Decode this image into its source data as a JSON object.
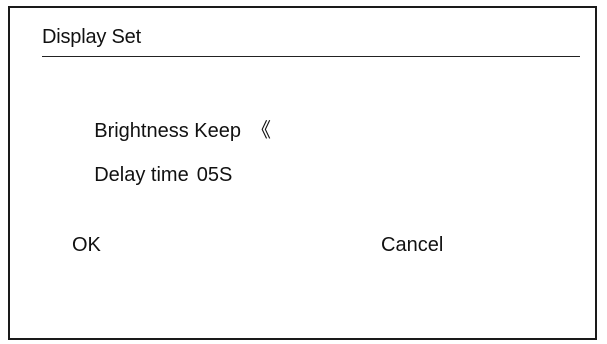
{
  "dialog": {
    "title": "Display Set",
    "settings": [
      {
        "label": "Brightness Keep",
        "value": "《"
      },
      {
        "label": "Delay time",
        "value": "05S"
      }
    ],
    "ok_label": "OK",
    "cancel_label": "Cancel"
  }
}
